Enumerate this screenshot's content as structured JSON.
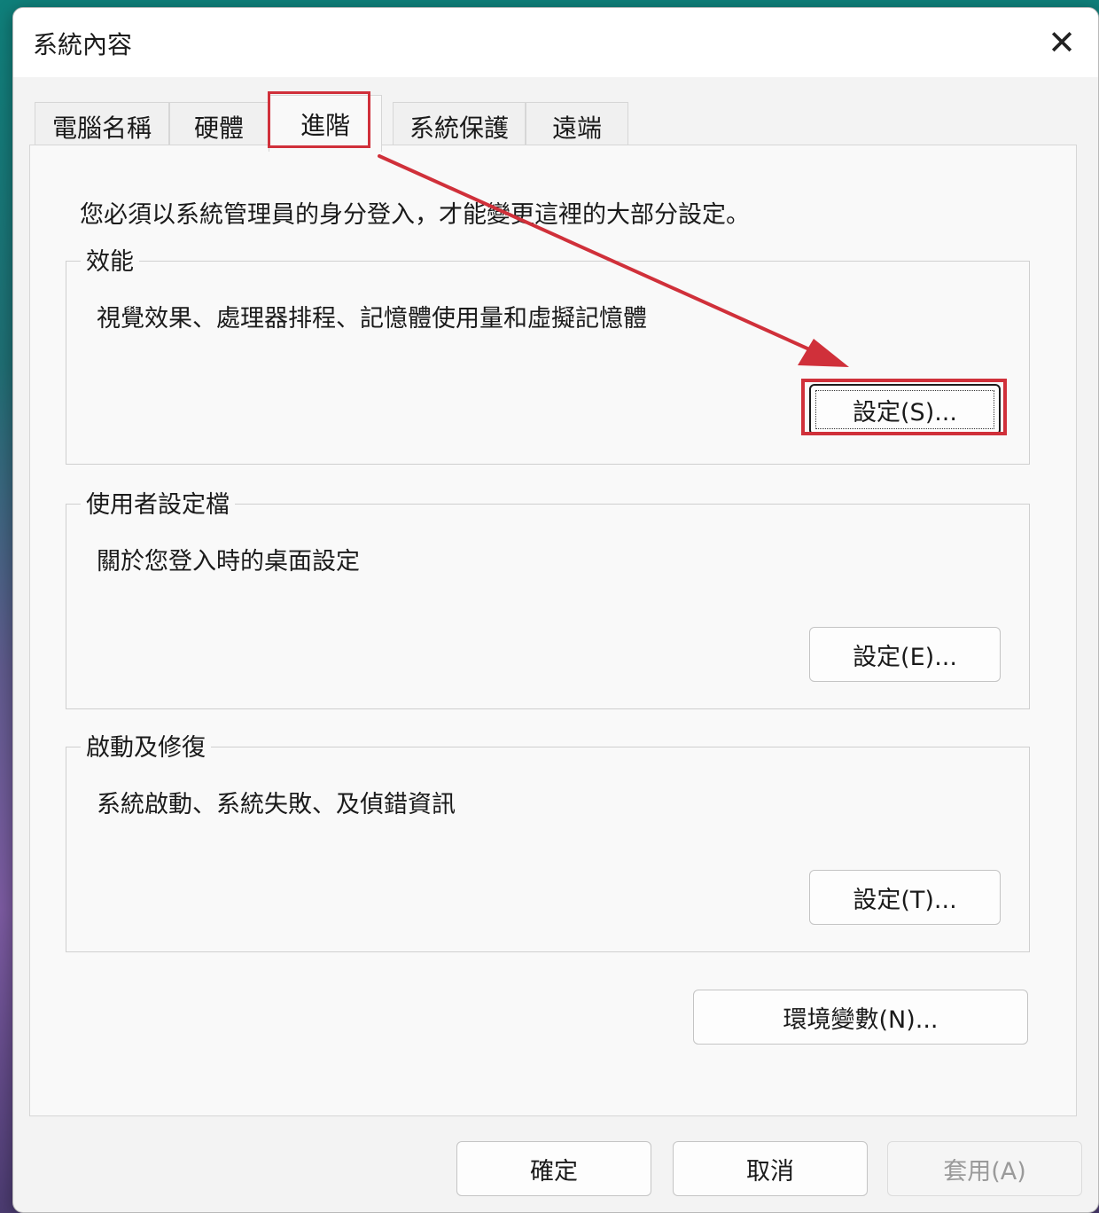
{
  "window": {
    "title": "系統內容",
    "close_glyph": "✕"
  },
  "tabs": [
    {
      "label": "電腦名稱"
    },
    {
      "label": "硬體"
    },
    {
      "label": "進階",
      "active": true
    },
    {
      "label": "系統保護"
    },
    {
      "label": "遠端"
    }
  ],
  "notice": "您必須以系統管理員的身分登入，才能變更這裡的大部分設定。",
  "performance": {
    "legend": "效能",
    "description": "視覺效果、處理器排程、記憶體使用量和虛擬記憶體",
    "button": "設定(S)..."
  },
  "user_profiles": {
    "legend": "使用者設定檔",
    "description": "關於您登入時的桌面設定",
    "button": "設定(E)..."
  },
  "startup_recovery": {
    "legend": "啟動及修復",
    "description": "系統啟動、系統失敗、及偵錯資訊",
    "button": "設定(T)..."
  },
  "env_button": "環境變數(N)...",
  "footer": {
    "ok": "確定",
    "cancel": "取消",
    "apply": "套用(A)"
  },
  "colors": {
    "highlight": "#d0303a",
    "dialog_bg": "#f3f3f3"
  }
}
